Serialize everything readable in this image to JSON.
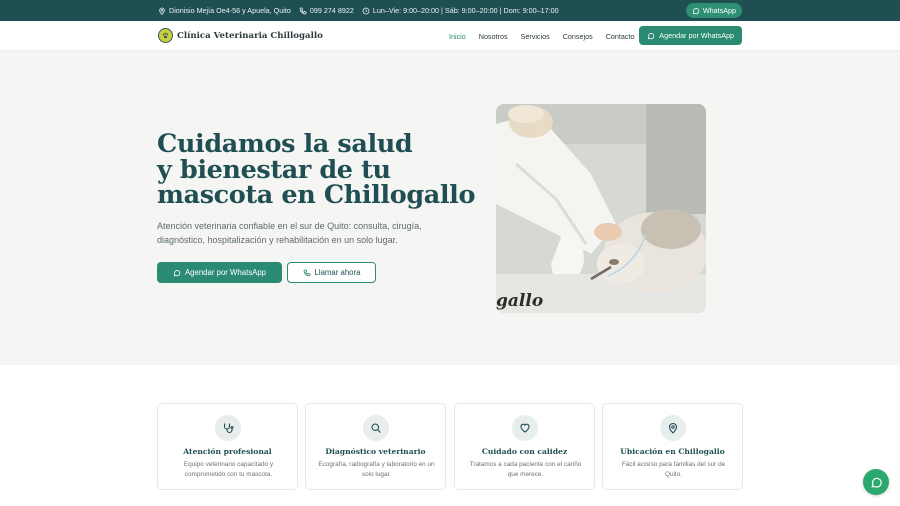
{
  "topbar": {
    "address": "Dionisio Mejía Oe4-56 y Apuela, Quito",
    "phone": "099 274 8922",
    "hours": "Lun–Vie: 9:00–20:00 | Sáb: 9:00–20:00 | Dom: 9:00–17:00",
    "whatsapp_label": "WhatsApp"
  },
  "header": {
    "brand": "Clínica Veterinaria Chillogallo",
    "nav": [
      {
        "label": "Inicio",
        "active": true
      },
      {
        "label": "Nosotros",
        "active": false
      },
      {
        "label": "Servicios",
        "active": false
      },
      {
        "label": "Consejos",
        "active": false
      },
      {
        "label": "Contacto",
        "active": false
      }
    ],
    "cta_label": "Agendar por WhatsApp"
  },
  "hero": {
    "title_lines": [
      "Cuidamos la salud",
      "y bienestar de tu",
      "mascota en Chillogallo"
    ],
    "subtitle": "Atención veterinaria confiable en el sur de Quito: consulta, cirugía, diagnóstico, hospitalización y rehabilitación en un solo lugar.",
    "primary_label": "Agendar por WhatsApp",
    "secondary_label": "Llamar ahora",
    "photo_caption_text": "gallo"
  },
  "features": [
    {
      "icon": "stethoscope-icon",
      "title": "Atención profesional",
      "desc": "Equipo veterinario capacitado y comprometido con tu mascota."
    },
    {
      "icon": "search-icon",
      "title": "Diagnóstico veterinario",
      "desc": "Ecografía, radiografía y laboratorio en un solo lugar."
    },
    {
      "icon": "heart-icon",
      "title": "Cuidado con calidez",
      "desc": "Tratamos a cada paciente con el cariño que merece."
    },
    {
      "icon": "map-pin-icon",
      "title": "Ubicación en Chillogallo",
      "desc": "Fácil acceso para familias del sur de Quito."
    }
  ],
  "colors": {
    "primary": "#2a8a72",
    "dark_teal": "#1f4f53",
    "whatsapp": "#2aa86d"
  }
}
